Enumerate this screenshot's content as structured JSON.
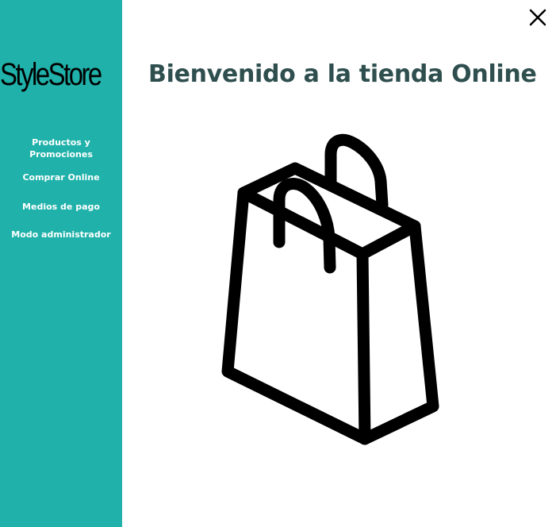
{
  "brand": {
    "logo_text": "StyleStore"
  },
  "sidebar": {
    "background_color": "#20b2aa",
    "items": [
      {
        "label": "Productos y Promociones"
      },
      {
        "label": "Comprar Online"
      },
      {
        "label": "Medios de pago"
      },
      {
        "label": "Modo administrador"
      }
    ]
  },
  "main": {
    "title": "Bienvenido a la tienda Online",
    "title_color": "#2f4f4f",
    "illustration_icon": "shopping-bag-icon"
  },
  "window": {
    "close_icon": "close-icon"
  }
}
